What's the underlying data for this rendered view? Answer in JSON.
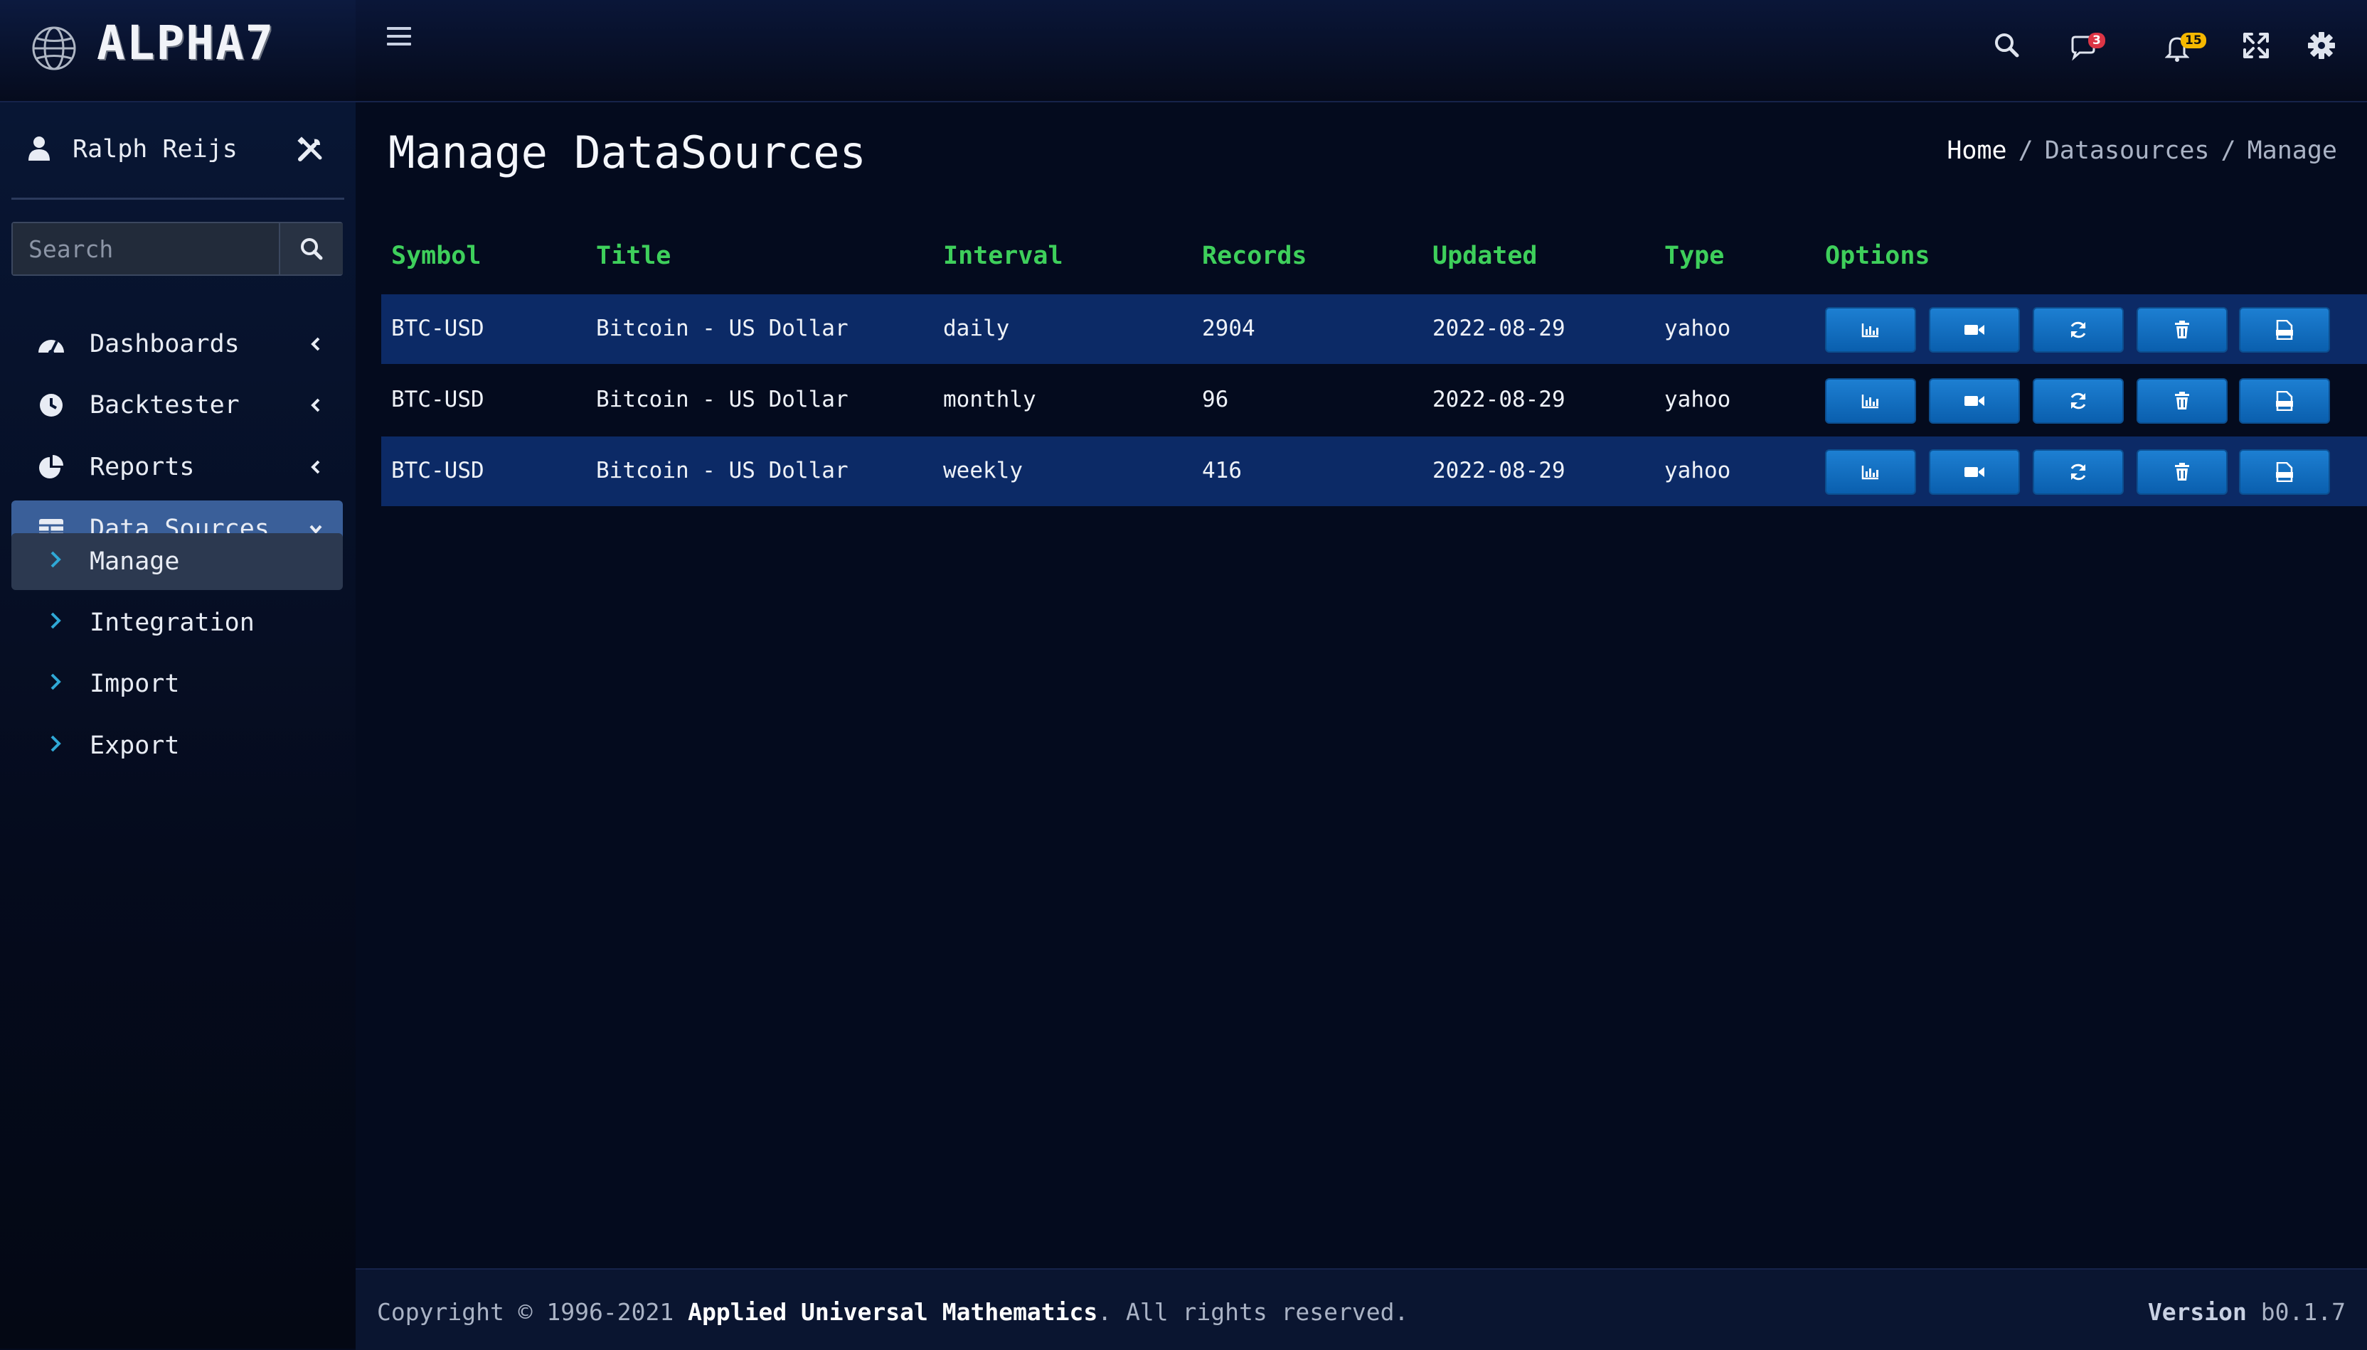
{
  "app": {
    "logo": "ALPHA7"
  },
  "header": {
    "messages_badge": "3",
    "notifications_badge": "15"
  },
  "sidebar": {
    "user_name": "Ralph Reijs",
    "search_placeholder": "Search",
    "items": [
      {
        "label": "Dashboards",
        "icon": "dashboard-icon"
      },
      {
        "label": "Backtester",
        "icon": "clock-icon"
      },
      {
        "label": "Reports",
        "icon": "pie-chart-icon"
      },
      {
        "label": "Data Sources",
        "icon": "table-icon"
      }
    ],
    "subitems": [
      {
        "label": "Manage"
      },
      {
        "label": "Integration"
      },
      {
        "label": "Import"
      },
      {
        "label": "Export"
      }
    ]
  },
  "main": {
    "title": "Manage DataSources",
    "breadcrumb": {
      "home": "Home",
      "section": "Datasources",
      "current": "Manage",
      "separator": "/"
    },
    "table": {
      "headers": [
        "Symbol",
        "Title",
        "Interval",
        "Records",
        "Updated",
        "Type",
        "Options"
      ],
      "rows": [
        {
          "symbol": "BTC-USD",
          "title": "Bitcoin - US Dollar",
          "interval": "daily",
          "records": "2904",
          "updated": "2022-08-29",
          "type": "yahoo"
        },
        {
          "symbol": "BTC-USD",
          "title": "Bitcoin - US Dollar",
          "interval": "monthly",
          "records": "96",
          "updated": "2022-08-29",
          "type": "yahoo"
        },
        {
          "symbol": "BTC-USD",
          "title": "Bitcoin - US Dollar",
          "interval": "weekly",
          "records": "416",
          "updated": "2022-08-29",
          "type": "yahoo"
        }
      ]
    }
  },
  "footer": {
    "copyright_prefix": "Copyright © 1996-2021",
    "company": "Applied Universal Mathematics",
    "copyright_suffix": ". All rights reserved.",
    "version_label": "Version",
    "version": "b0.1.7"
  },
  "colors": {
    "accent_green": "#3ecf5b",
    "button_blue": "#1d7fd2",
    "active_nav": "#3a5f99",
    "row_alt": "#0c2a66"
  }
}
